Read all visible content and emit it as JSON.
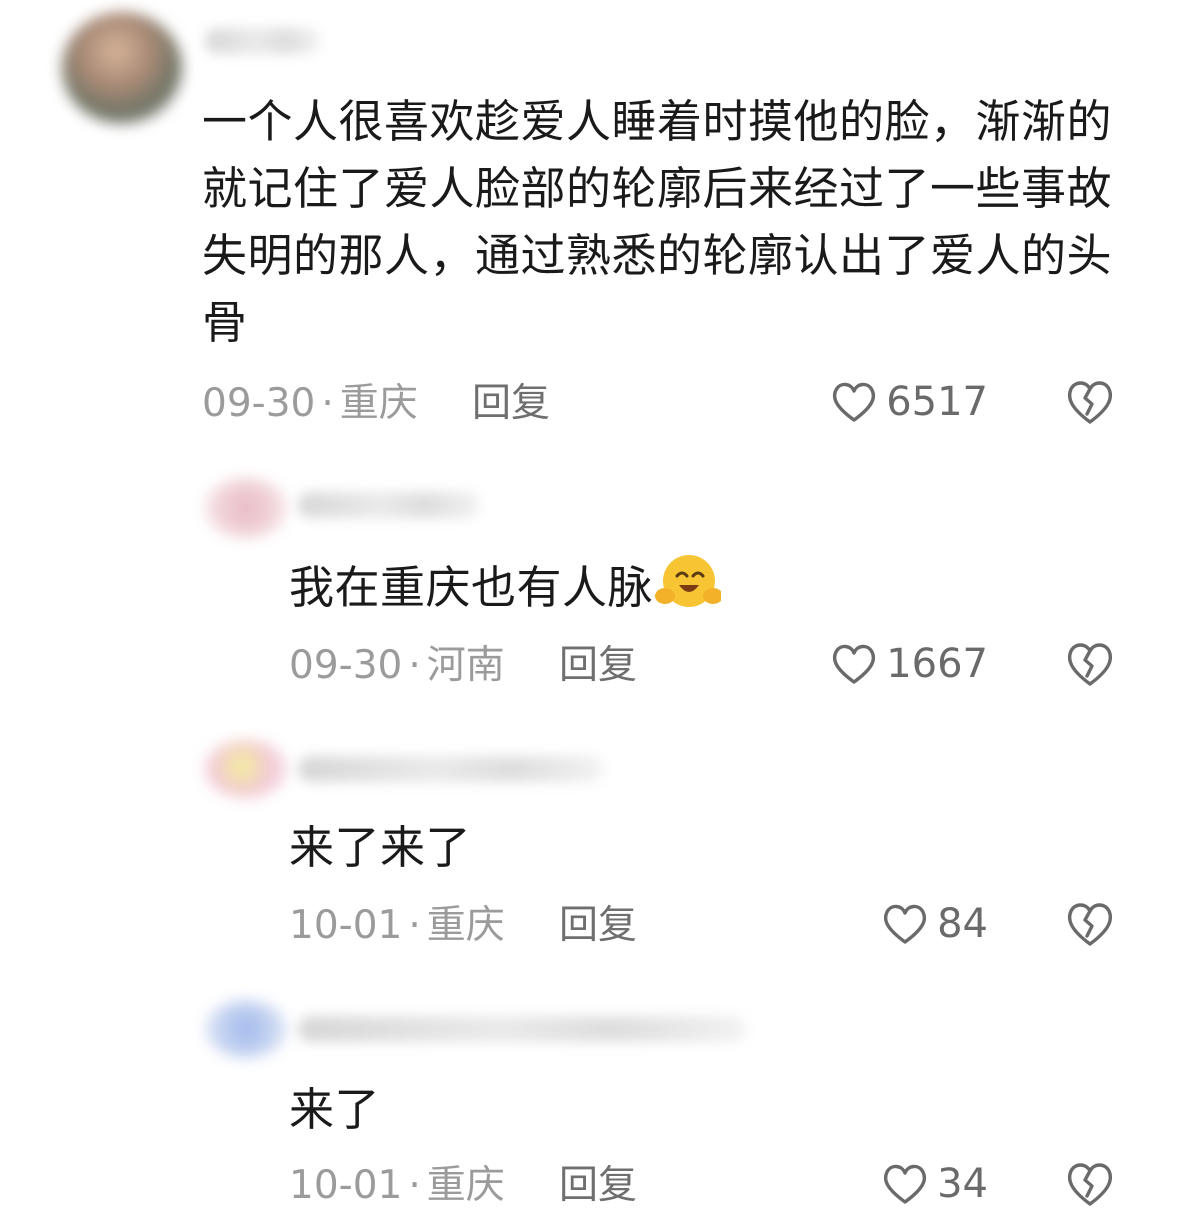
{
  "comments": [
    {
      "text": "一个人很喜欢趁爱人睡着时摸他的脸，渐渐的就记住了爱人脸部的轮廓后来经过了一些事故失明的那人，通过熟悉的轮廓认出了爱人的头骨",
      "date": "09-30",
      "separator": "·",
      "location": "重庆",
      "reply_label": "回复",
      "likes": "6517",
      "like_icon": "heart-outline-icon",
      "dislike_icon": "broken-heart-icon"
    },
    {
      "text": "我在重庆也有人脉",
      "emoji": "hug-smile-emoji",
      "date": "09-30",
      "separator": "·",
      "location": "河南",
      "reply_label": "回复",
      "likes": "1667",
      "like_icon": "heart-outline-icon",
      "dislike_icon": "broken-heart-icon"
    },
    {
      "text": "来了来了",
      "date": "10-01",
      "separator": "·",
      "location": "重庆",
      "reply_label": "回复",
      "likes": "84",
      "like_icon": "heart-outline-icon",
      "dislike_icon": "broken-heart-icon"
    },
    {
      "text": "来了",
      "date": "10-01",
      "separator": "·",
      "location": "重庆",
      "reply_label": "回复",
      "likes": "34",
      "like_icon": "heart-outline-icon",
      "dislike_icon": "broken-heart-icon"
    }
  ],
  "colors": {
    "text": "#1a1a1a",
    "meta": "#9b9b9b",
    "reply": "#6f6f6f",
    "icon": "#6a6a6a",
    "emoji": "#f7c533"
  }
}
